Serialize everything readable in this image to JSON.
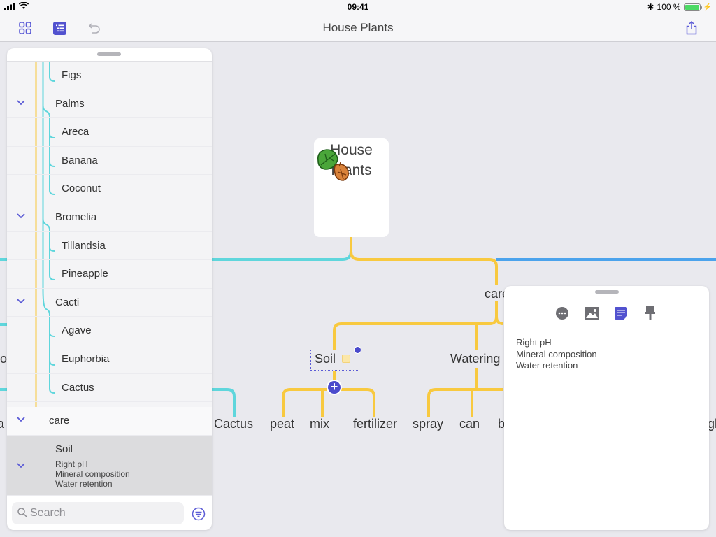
{
  "status_bar": {
    "time": "09:41",
    "battery_percent_text": "100 %",
    "battery_level": 1.0,
    "signal_icon": "cellular-signal-icon",
    "wifi_icon": "wifi-icon",
    "bluetooth_icon": "bluetooth-icon",
    "charging_icon": "charging-bolt-icon"
  },
  "navbar": {
    "title": "House Plants",
    "buttons": [
      {
        "name": "grid-view-button",
        "icon": "grid-icon"
      },
      {
        "name": "outline-view-button",
        "icon": "outline-list-icon",
        "active": true
      },
      {
        "name": "undo-button",
        "icon": "undo-icon",
        "enabled": false
      },
      {
        "name": "share-button",
        "icon": "share-icon"
      }
    ]
  },
  "colors": {
    "accent": "#4b4bcc",
    "branch_yellow": "#f8c93f",
    "branch_cyan": "#5fd6dc",
    "branch_blue": "#4ba3ec",
    "canvas_bg": "#e9e9ee"
  },
  "mindmap": {
    "root": {
      "title_line1": "House",
      "title_line2": "Plants",
      "icon": "leaves-icon"
    },
    "branch_care": {
      "label": "care"
    },
    "nodes": {
      "soil": "Soil",
      "watering": "Watering",
      "cactus": "Cactus",
      "peat": "peat",
      "mix": "mix",
      "fertilizer": "fertilizer",
      "spray": "spray",
      "can": "can",
      "b_partial": "b",
      "left_partial_ro": "ro",
      "left_partial_a": "a",
      "right_partial_gh": "gh"
    },
    "add_button": "+"
  },
  "outline": {
    "rows": [
      {
        "label": "Figs",
        "level": 3,
        "collapsible": false
      },
      {
        "label": "Palms",
        "level": 2,
        "collapsible": true
      },
      {
        "label": "Areca",
        "level": 3,
        "collapsible": false
      },
      {
        "label": "Banana",
        "level": 3,
        "collapsible": false
      },
      {
        "label": "Coconut",
        "level": 3,
        "collapsible": false
      },
      {
        "label": "Bromelia",
        "level": 2,
        "collapsible": true
      },
      {
        "label": "Tillandsia",
        "level": 3,
        "collapsible": false
      },
      {
        "label": "Pineapple",
        "level": 3,
        "collapsible": false
      },
      {
        "label": "Cacti",
        "level": 2,
        "collapsible": true
      },
      {
        "label": "Agave",
        "level": 3,
        "collapsible": false
      },
      {
        "label": "Euphorbia",
        "level": 3,
        "collapsible": false
      },
      {
        "label": "Cactus",
        "level": 3,
        "collapsible": false
      },
      {
        "label": "care",
        "level": 1,
        "collapsible": true
      },
      {
        "label": "Soil",
        "level": 2,
        "collapsible": true,
        "selected": true,
        "note": [
          "Right pH",
          "Mineral composition",
          "Water retention"
        ]
      }
    ],
    "search_placeholder": "Search",
    "filter_icon": "filter-icon"
  },
  "inspector": {
    "tabs": [
      {
        "name": "more-tab",
        "icon": "more-icon"
      },
      {
        "name": "image-tab",
        "icon": "image-icon"
      },
      {
        "name": "notes-tab",
        "icon": "notes-icon",
        "active": true
      },
      {
        "name": "style-tab",
        "icon": "paintbrush-icon"
      }
    ],
    "notes": [
      "Right pH",
      "Mineral composition",
      "Water retention"
    ]
  }
}
